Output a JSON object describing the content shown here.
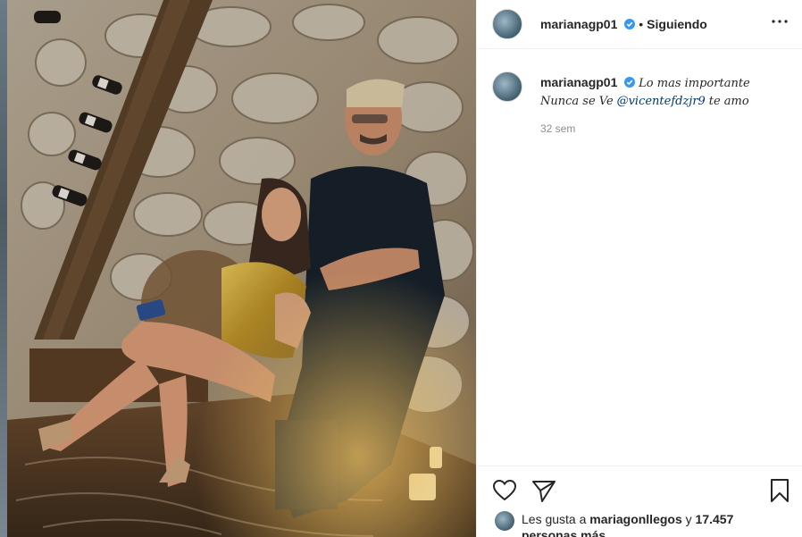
{
  "post": {
    "username": "marianagp01",
    "separator": "•",
    "follow_status": "Siguiendo",
    "caption_line1": "Lo mas importante",
    "caption_prefix": "Nunca se Ve",
    "caption_mention": "@vicentefdzjr9",
    "caption_suffix": "te amo",
    "time_ago": "32 sem"
  },
  "likes": {
    "prefix": "Les gusta a",
    "user": "mariagonllegos",
    "conj": "y",
    "count_text": "17.457 personas más"
  },
  "icons": {
    "more": "more-options-icon",
    "like": "heart-icon",
    "share": "send-icon",
    "save": "bookmark-icon",
    "verified": "verified-badge-icon"
  },
  "colors": {
    "verified": "#3897f0",
    "link": "#00376b",
    "muted": "#8e8e8e"
  }
}
